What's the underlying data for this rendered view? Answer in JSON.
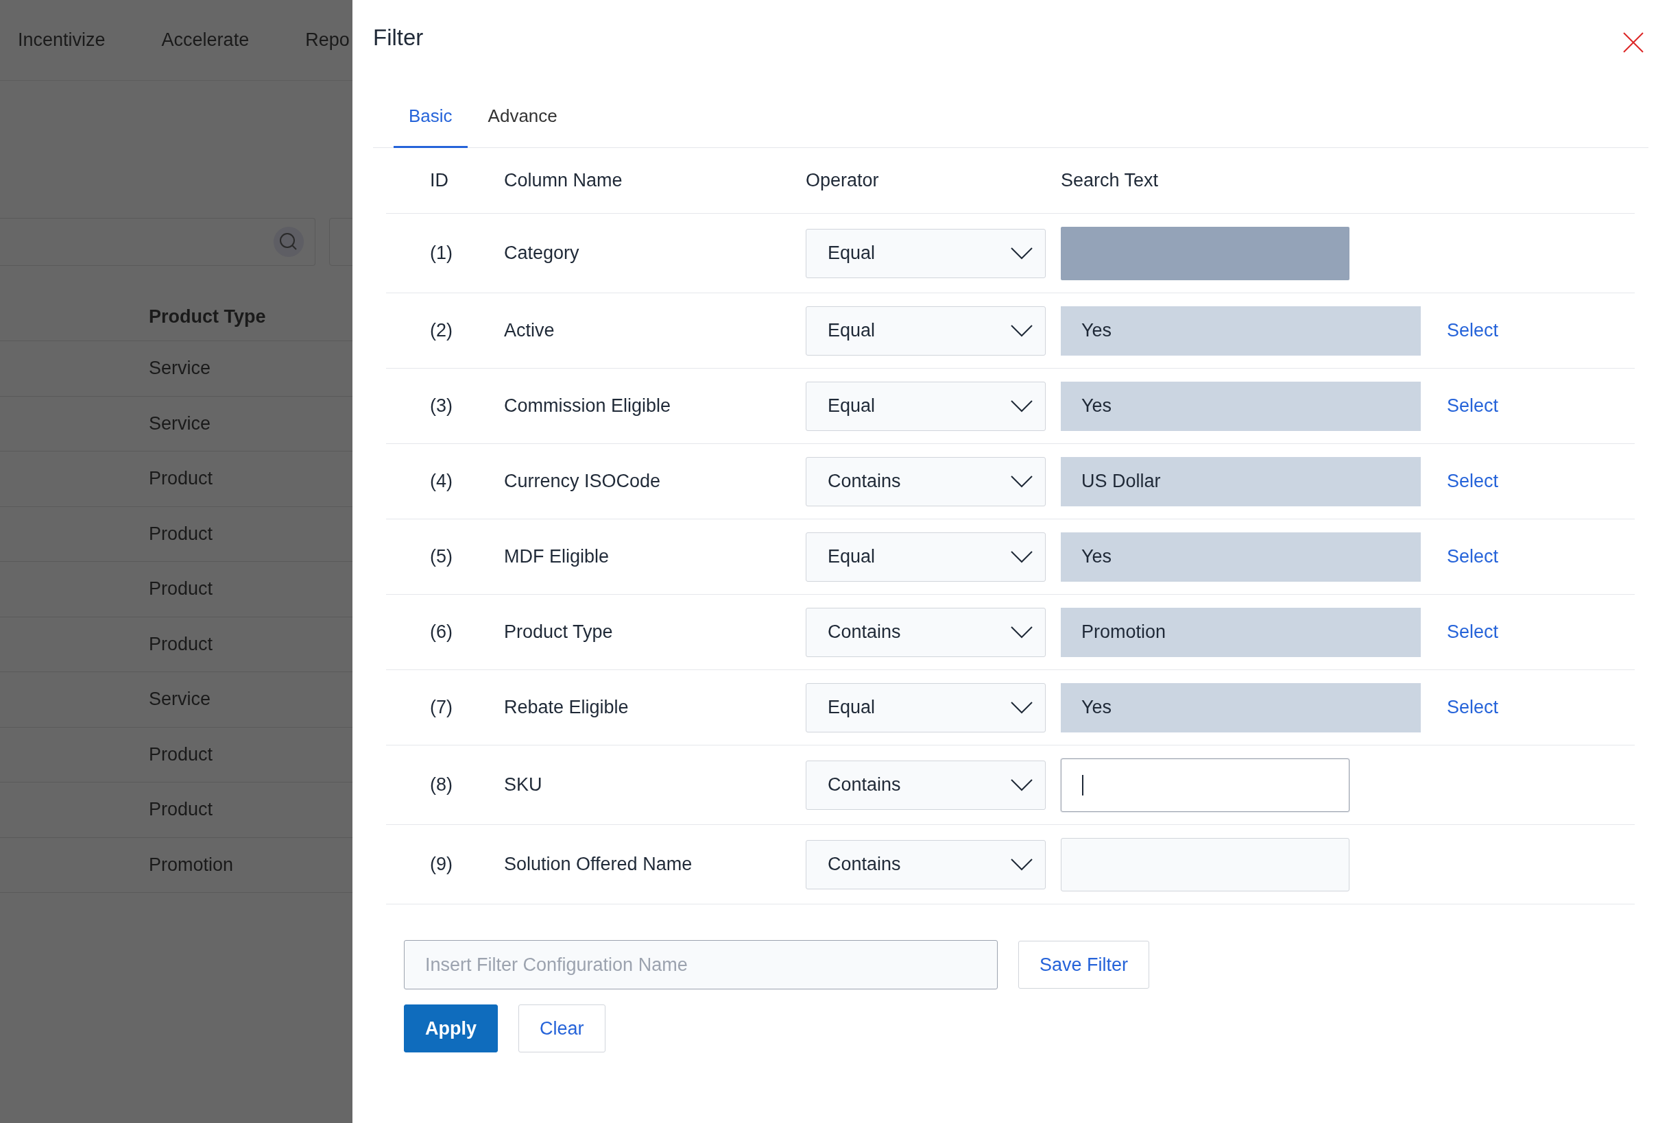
{
  "background": {
    "nav": [
      "Incentivize",
      "Accelerate",
      "Repo"
    ],
    "table": {
      "column": "Product Type",
      "rows": [
        "Service",
        "Service",
        "Product",
        "Product",
        "Product",
        "Product",
        "Service",
        "Product",
        "Product",
        "Promotion"
      ]
    }
  },
  "dialog": {
    "title": "Filter",
    "tabs": [
      {
        "label": "Basic",
        "selected": true
      },
      {
        "label": "Advance",
        "selected": false
      }
    ],
    "columns": [
      "ID",
      "Column Name",
      "Operator",
      "Search Text"
    ],
    "rows": [
      {
        "id": "(1)",
        "name": "Category",
        "operator": "Equal",
        "search": {
          "kind": "locked"
        }
      },
      {
        "id": "(2)",
        "name": "Active",
        "operator": "Equal",
        "search": {
          "kind": "lookup",
          "value": "Yes",
          "link": "Select"
        }
      },
      {
        "id": "(3)",
        "name": "Commission Eligible",
        "operator": "Equal",
        "search": {
          "kind": "lookup",
          "value": "Yes",
          "link": "Select"
        }
      },
      {
        "id": "(4)",
        "name": "Currency ISOCode",
        "operator": "Contains",
        "search": {
          "kind": "lookup",
          "value": "US Dollar",
          "link": "Select"
        }
      },
      {
        "id": "(5)",
        "name": "MDF Eligible",
        "operator": "Equal",
        "search": {
          "kind": "lookup",
          "value": "Yes",
          "link": "Select"
        }
      },
      {
        "id": "(6)",
        "name": "Product Type",
        "operator": "Contains",
        "search": {
          "kind": "lookup",
          "value": "Promotion",
          "link": "Select"
        }
      },
      {
        "id": "(7)",
        "name": "Rebate Eligible",
        "operator": "Equal",
        "search": {
          "kind": "lookup",
          "value": "Yes",
          "link": "Select"
        }
      },
      {
        "id": "(8)",
        "name": "SKU",
        "operator": "Contains",
        "search": {
          "kind": "text",
          "focused": true
        }
      },
      {
        "id": "(9)",
        "name": "Solution Offered Name",
        "operator": "Contains",
        "search": {
          "kind": "text",
          "focused": false
        }
      }
    ],
    "config": {
      "placeholder": "Insert Filter Configuration Name",
      "save": "Save Filter"
    },
    "buttons": [
      {
        "label": "Apply",
        "kind": "primary"
      },
      {
        "label": "Clear",
        "kind": "secondary"
      }
    ]
  }
}
